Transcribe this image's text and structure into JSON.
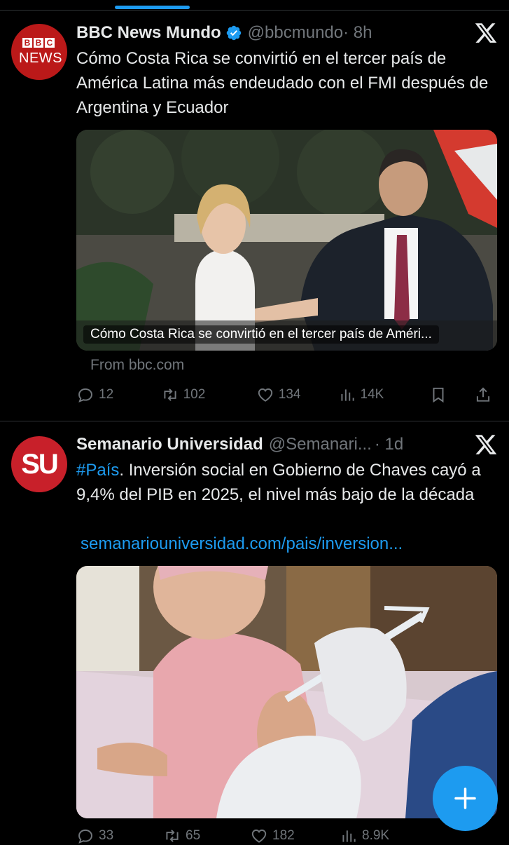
{
  "tweets": [
    {
      "name": "BBC News Mundo",
      "handle": "@bbcmundo",
      "time": "· 8h",
      "avatar_text": "NEWS",
      "text": "Cómo Costa Rica se convirtió en el tercer país de América Latina más endeudado con el FMI después de Argentina y Ecuador",
      "card_caption": "Cómo Costa Rica se convirtió en el tercer país de Améri...",
      "source": "From bbc.com",
      "replies": "12",
      "retweets": "102",
      "likes": "134",
      "views": "14K"
    },
    {
      "name": "Semanario Universidad",
      "handle": "@Semanari...",
      "time": "· 1d",
      "avatar_text": "SU",
      "hashtag": "#País",
      "text": ". Inversión social en Gobierno de Chaves cayó a 9,4% del PIB en 2025, el nivel más bajo de la década",
      "link": "semanariouniversidad.com/pais/inversion...",
      "replies": "33",
      "retweets": "65",
      "likes": "182",
      "views": "8.9K"
    }
  ],
  "fab_label": "+",
  "colors": {
    "accent": "#1d9bf0",
    "bbc_red": "#bb1919",
    "su_red": "#c8202a",
    "muted": "#71767b"
  }
}
